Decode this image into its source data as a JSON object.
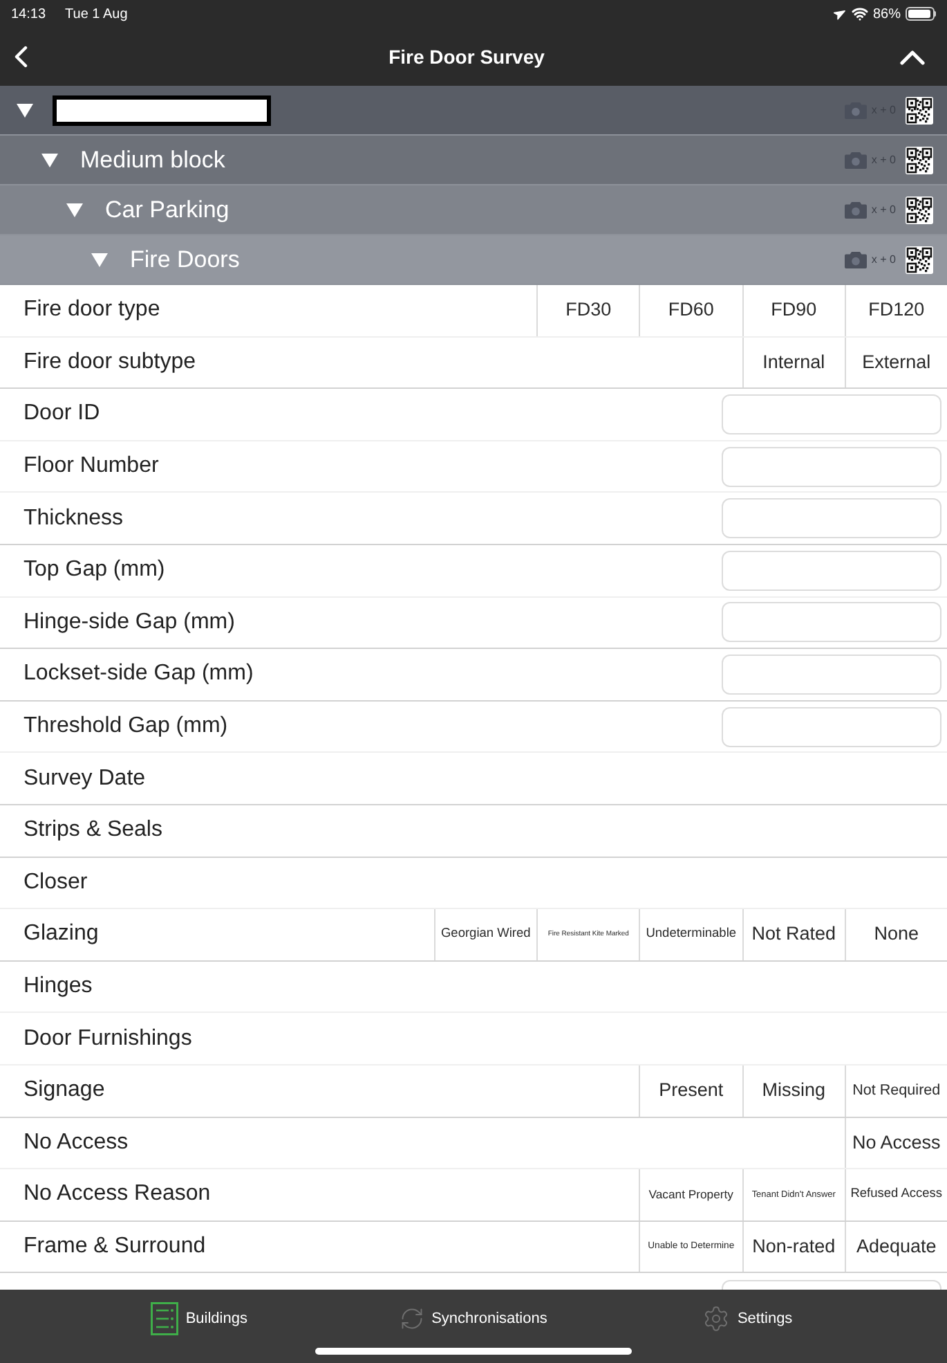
{
  "status_bar": {
    "time": "14:13",
    "date": "Tue 1 Aug",
    "battery": "86%"
  },
  "nav_bar": {
    "title": "Fire Door Survey"
  },
  "tree": [
    {
      "redacted": true,
      "expanded": true,
      "photo_count": "x + 0",
      "children": [
        {
          "label": "Medium block",
          "expanded": true,
          "photo_count": "x + 0",
          "children": [
            {
              "label": "Car Parking",
              "expanded": true,
              "photo_count": "x + 0",
              "children": [
                {
                  "label": "Fire Doors",
                  "expanded": true,
                  "photo_count": "x + 0"
                }
              ]
            }
          ]
        }
      ]
    }
  ],
  "form": {
    "sections": [
      {
        "rows": [
          {
            "kind": "options",
            "label": "Fire door type",
            "options": [
              {
                "label": "FD30",
                "selected": false
              },
              {
                "label": "FD60",
                "selected": false
              },
              {
                "label": "FD90",
                "selected": false
              },
              {
                "label": "FD120",
                "selected": false
              }
            ]
          },
          {
            "kind": "options",
            "label": "Fire door subtype",
            "options": [
              {
                "label": "Internal",
                "selected": false
              },
              {
                "label": "External",
                "selected": false
              }
            ]
          }
        ]
      },
      {
        "rows": [
          {
            "kind": "input",
            "label": "Door ID"
          },
          {
            "kind": "input",
            "label": "Floor Number"
          },
          {
            "kind": "input",
            "label": "Thickness"
          }
        ]
      },
      {
        "rows": [
          {
            "kind": "input",
            "label": "Top Gap (mm)"
          },
          {
            "kind": "input",
            "label": "Hinge-side Gap (mm)"
          }
        ]
      },
      {
        "rows": [
          {
            "kind": "input",
            "label": "Lockset-side Gap (mm)"
          }
        ]
      },
      {
        "rows": [
          {
            "kind": "input",
            "label": "Threshold Gap (mm)"
          },
          {
            "kind": "plain",
            "label": "Survey Date"
          }
        ]
      },
      {
        "rows": [
          {
            "kind": "plain",
            "label": "Strips & Seals"
          }
        ]
      },
      {
        "rows": [
          {
            "kind": "plain",
            "label": "Closer"
          },
          {
            "kind": "options",
            "label": "Glazing",
            "options": [
              {
                "label": "Georgian Wired",
                "selected": false
              },
              {
                "label": "Fire Resistant Kite Marked",
                "selected": false
              },
              {
                "label": "Undeterminable",
                "selected": false
              },
              {
                "label": "Not Rated",
                "selected": false
              },
              {
                "label": "None",
                "selected": false
              }
            ]
          }
        ]
      },
      {
        "rows": [
          {
            "kind": "plain",
            "label": "Hinges"
          },
          {
            "kind": "plain",
            "label": "Door Furnishings"
          },
          {
            "kind": "options",
            "label": "Signage",
            "options": [
              {
                "label": "Present",
                "selected": false
              },
              {
                "label": "Missing",
                "selected": false
              },
              {
                "label": "Not Required",
                "selected": false
              }
            ]
          }
        ]
      },
      {
        "rows": [
          {
            "kind": "options",
            "label": "No Access",
            "options": [
              {
                "label": "No Access",
                "selected": false
              }
            ]
          },
          {
            "kind": "options",
            "label": "No Access Reason",
            "options": [
              {
                "label": "Vacant Property",
                "selected": false
              },
              {
                "label": "Tenant Didn't Answer",
                "selected": false
              },
              {
                "label": "Refused Access",
                "selected": false
              }
            ]
          }
        ]
      },
      {
        "rows": [
          {
            "kind": "options",
            "label": "Frame & Surround",
            "options": [
              {
                "label": "Unable to Determine",
                "selected": false
              },
              {
                "label": "Non-rated",
                "selected": false
              },
              {
                "label": "Adequate",
                "selected": false
              }
            ]
          }
        ]
      },
      {
        "rows": [
          {
            "kind": "input"
          }
        ]
      }
    ]
  },
  "tab_bar": {
    "items": [
      {
        "kind": "buildings",
        "label": "Buildings",
        "selected": true
      },
      {
        "kind": "sync",
        "label": "Synchronisations",
        "selected": false
      },
      {
        "kind": "settings",
        "label": "Settings",
        "selected": false
      }
    ]
  }
}
